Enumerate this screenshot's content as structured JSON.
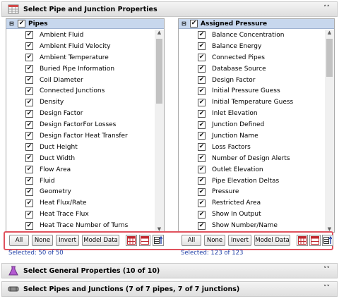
{
  "header": {
    "title": "Select Pipe and Junction Properties"
  },
  "left_panel": {
    "title": "Pipes",
    "items": [
      "Ambient Fluid",
      "Ambient Fluid Velocity",
      "Ambient Temperature",
      "Buried Pipe Information",
      "Coil Diameter",
      "Connected Junctions",
      "Density",
      "Design Factor",
      "Design FactorFor Losses",
      "Design Factor Heat Transfer",
      "Duct Height",
      "Duct Width",
      "Flow Area",
      "Fluid",
      "Geometry",
      "Heat Flux/Rate",
      "Heat Trace Flux",
      "Heat Trace Number of Turns"
    ],
    "buttons": {
      "all": "All",
      "none": "None",
      "invert": "Invert",
      "model_data": "Model Data"
    },
    "selected_text": "Selected: 50 of 50"
  },
  "right_panel": {
    "title": "Assigned Pressure",
    "items": [
      "Balance Concentration",
      "Balance Energy",
      "Connected Pipes",
      "Database Source",
      "Design Factor",
      "Initial Pressure Guess",
      "Initial Temperature Guess",
      "Inlet Elevation",
      "Junction Defined",
      "Junction Name",
      "Loss Factors",
      "Number of Design Alerts",
      "Outlet Elevation",
      "Pipe Elevation Deltas",
      "Pressure",
      "Restricted Area",
      "Show In Output",
      "Show Number/Name"
    ],
    "buttons": {
      "all": "All",
      "none": "None",
      "invert": "Invert",
      "model_data": "Model Data"
    },
    "selected_text": "Selected: 123 of 123"
  },
  "general_section": {
    "title": "Select General Properties (10 of 10)"
  },
  "pipes_section": {
    "title": "Select Pipes and Junctions (7 of 7 pipes, 7 of 7 junctions)"
  },
  "colors": {
    "panel_header": "#c7d7ed",
    "highlight_box": "#e0525e",
    "selected_text": "#1f3fa8"
  }
}
